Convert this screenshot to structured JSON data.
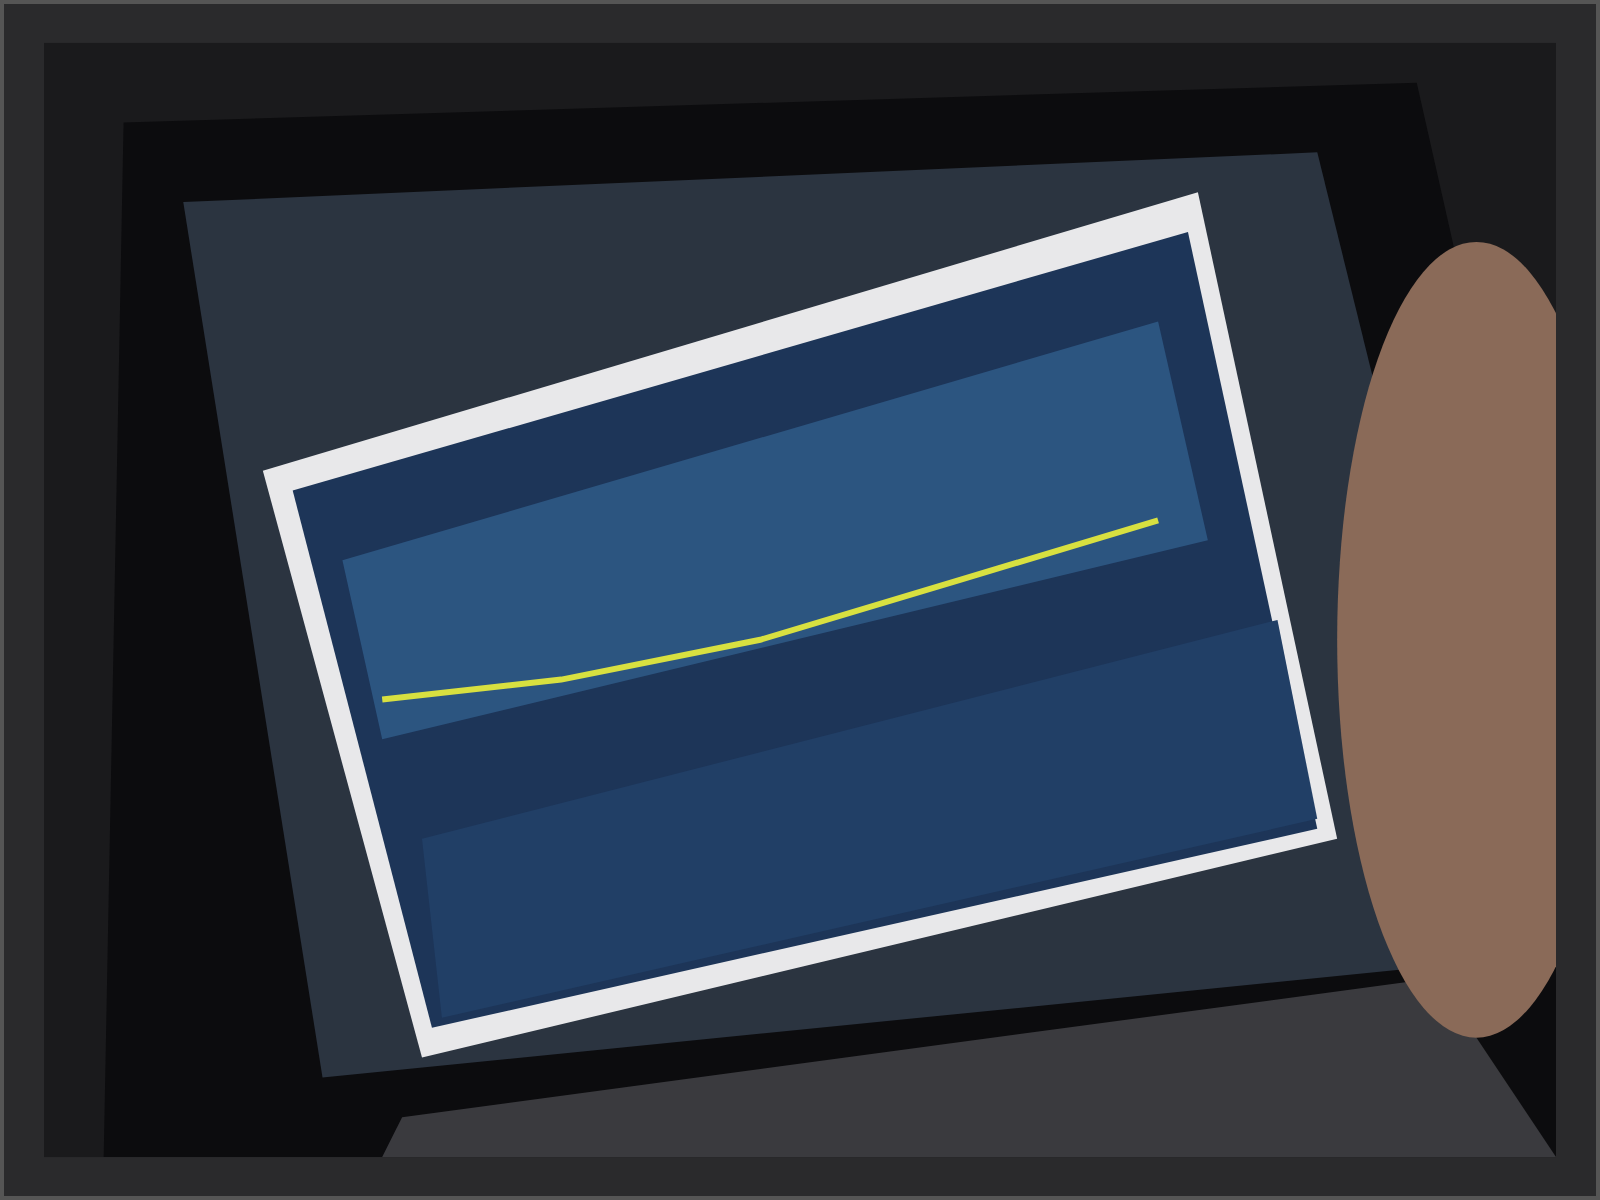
{
  "photo": {
    "kind": "laptop-screen"
  }
}
